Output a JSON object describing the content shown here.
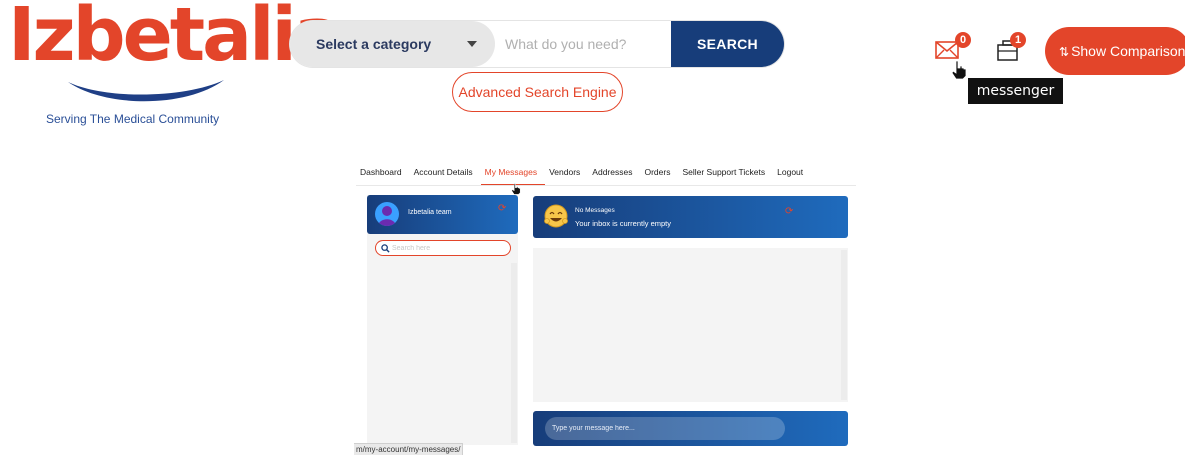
{
  "brand": {
    "name": "Izbetalia",
    "tagline": "Serving The Medical Community",
    "accent_color": "#e3452a",
    "navy_color": "#173d7a"
  },
  "header": {
    "category_select": "Select a category",
    "search_placeholder": "What do you need?",
    "search_button": "SEARCH",
    "advanced_search": "Advanced Search Engine",
    "messages_icon": "envelope-icon",
    "messages_count": "0",
    "compare_icon": "briefcase-icon",
    "compare_count": "1",
    "tooltip": "messenger",
    "show_comparison": "Show Comparison"
  },
  "account_nav": {
    "items": [
      {
        "label": "Dashboard"
      },
      {
        "label": "Account Details"
      },
      {
        "label": "My Messages"
      },
      {
        "label": "Vendors"
      },
      {
        "label": "Addresses"
      },
      {
        "label": "Orders"
      },
      {
        "label": "Seller Support Tickets"
      },
      {
        "label": "Logout"
      }
    ],
    "active": "My Messages"
  },
  "contacts": {
    "team_name": "Izbetalia team",
    "search_placeholder": "Search here"
  },
  "chat": {
    "title": "No Messages",
    "subtitle": "Your inbox is currently empty",
    "input_placeholder": "Type your message here..."
  },
  "status_url": "m/my-account/my-messages/"
}
